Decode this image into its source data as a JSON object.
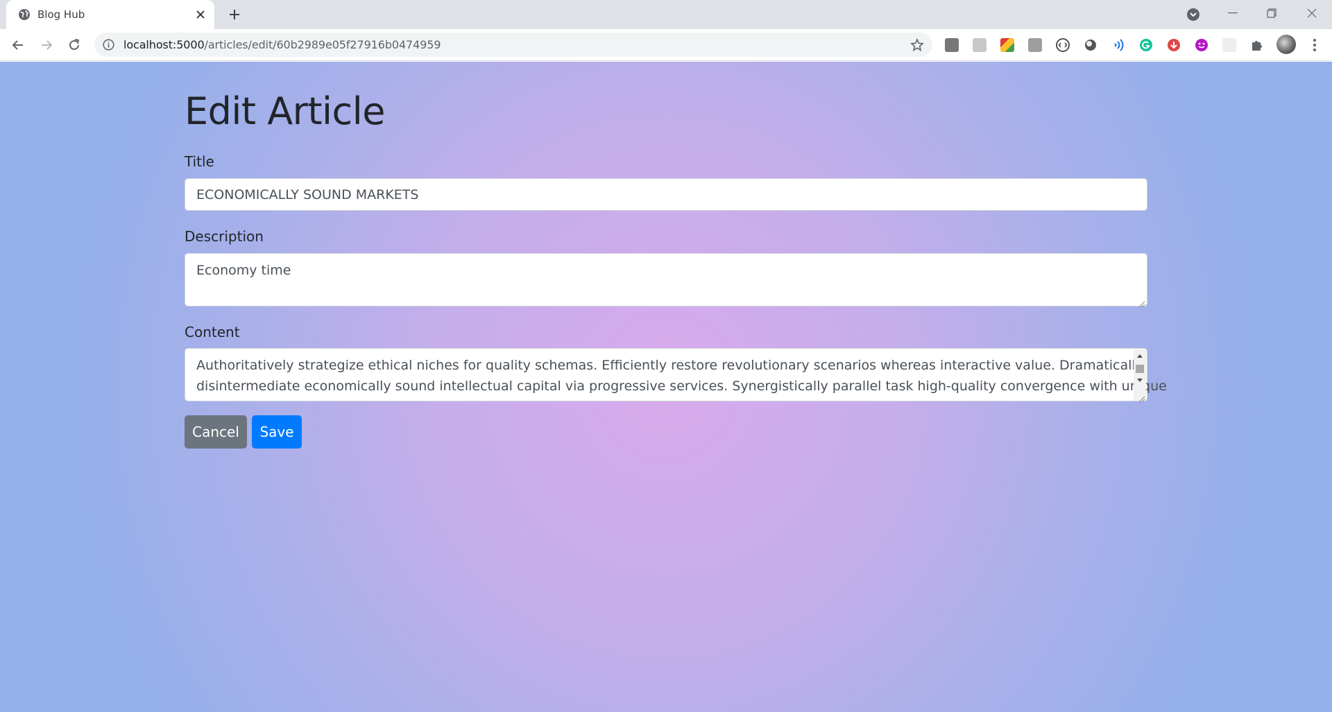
{
  "browser": {
    "tab": {
      "title": "Blog Hub",
      "favicon": "globe-icon"
    },
    "url_host": "localhost:5000",
    "url_path": "/articles/edit/60b2989e05f27916b0474959",
    "extensions": [
      "pdf-icon",
      "reader-icon",
      "grid-icon",
      "book-icon",
      "code-icon",
      "circle-icon",
      "audio-icon",
      "grammarly-icon",
      "download-icon",
      "emoji-icon",
      "blank-icon",
      "puzzle-icon"
    ]
  },
  "page": {
    "heading": "Edit Article",
    "title_label": "Title",
    "title_value": "ECONOMICALLY SOUND MARKETS",
    "description_label": "Description",
    "description_value": "Economy time",
    "content_label": "Content",
    "content_line1": "Authoritatively strategize ethical niches for quality schemas. Efficiently restore revolutionary scenarios whereas interactive value. Dramatically",
    "content_line2": "disintermediate economically sound intellectual capital via progressive services. Synergistically parallel task high-quality convergence with unique",
    "cancel_label": "Cancel",
    "save_label": "Save"
  },
  "colors": {
    "cancel_button": "#6c757d",
    "save_button": "#007bff",
    "text": "#212529"
  }
}
